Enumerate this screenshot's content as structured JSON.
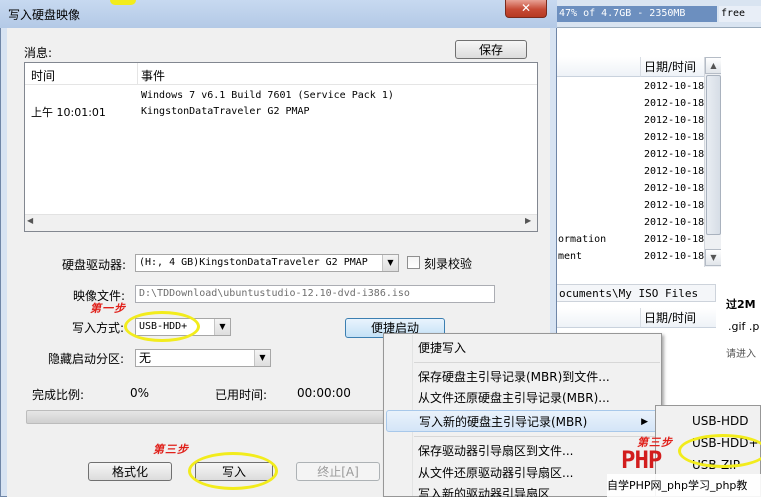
{
  "background_window": {
    "status_text": "47% of 4.7GB - 2350MB free",
    "status_used": "47% of 4.7GB - 2350MB ",
    "status_free": "free",
    "date_col_header": "日期/时间",
    "dates": [
      "2012-10-18",
      "2012-10-18",
      "2012-10-18",
      "2012-10-18",
      "2012-10-18",
      "2012-10-18",
      "2012-10-18",
      "2012-10-18",
      "2012-10-18",
      "2012-10-18",
      "2012-10-18"
    ],
    "partial_rows": [
      "ormation",
      "ment"
    ],
    "path_text": "ocuments\\My ISO Files",
    "date_col_header_2": "日期/时间",
    "size_fragment": "过2M",
    "ext_fragment": ".gif .p",
    "hint_fragment": "请进入"
  },
  "dialog": {
    "title": "写入硬盘映像",
    "close_label": "✕",
    "messages_label": "消息:",
    "save_button": "保存",
    "log": {
      "columns": [
        "时间",
        "事件"
      ],
      "rows": [
        {
          "time": "",
          "event": "Windows 7 v6.1 Build 7601 (Service Pack 1)"
        },
        {
          "time": "上午 10:01:01",
          "event": "KingstonDataTraveler G2 PMAP"
        }
      ]
    },
    "disk_drive_label": "硬盘驱动器:",
    "disk_drive_value": "(H:, 4 GB)KingstonDataTraveler G2 PMAP",
    "verify_label": "刻录校验",
    "image_file_label": "映像文件:",
    "image_file_value": "D:\\TDDownload\\ubuntustudio-12.10-dvd-i386.iso",
    "write_method_label": "写入方式:",
    "write_method_value": "USB-HDD+",
    "quick_boot_button": "便捷启动",
    "hidden_partition_label": "隐藏启动分区:",
    "hidden_partition_value": "无",
    "progress_label": "完成比例:",
    "progress_value": "0%",
    "progress_fraction": 0,
    "elapsed_label": "已用时间:",
    "elapsed_value": "00:00:00",
    "format_button": "格式化",
    "write_button": "写入",
    "stop_button": "终止[A]"
  },
  "annotations": {
    "step1": "第一步",
    "step3_left": "第三步",
    "step3_right": "第三步"
  },
  "context_menu": {
    "items": [
      "便捷写入",
      "保存硬盘主引导记录(MBR)到文件...",
      "从文件还原硬盘主引导记录(MBR)...",
      "写入新的硬盘主引导记录(MBR)",
      "保存驱动器引导扇区到文件...",
      "从文件还原驱动器引导扇区...",
      "写入新的驱动器引导扇区"
    ],
    "submenu": [
      "USB-HDD",
      "USB-HDD+",
      "USB-ZIP"
    ]
  },
  "watermark": {
    "logo": "PHP",
    "text": "自学PHP网_php学习_php教"
  },
  "colors": {
    "accent_yellow": "#f2ec1c",
    "annotation_red": "#e0201a"
  }
}
